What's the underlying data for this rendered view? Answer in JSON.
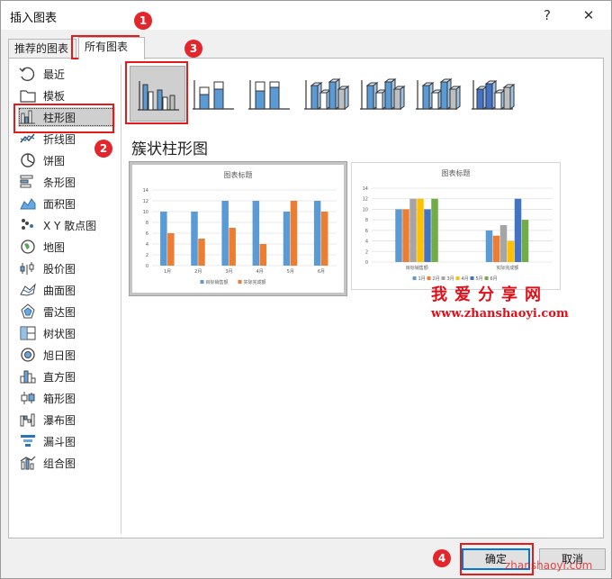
{
  "window": {
    "title": "插入图表",
    "help_glyph": "?",
    "close_glyph": "✕"
  },
  "tabs": [
    {
      "label": "推荐的图表",
      "active": false
    },
    {
      "label": "所有图表",
      "active": true
    }
  ],
  "sidebar": {
    "items": [
      {
        "label": "最近",
        "icon": "recent-icon"
      },
      {
        "label": "模板",
        "icon": "template-folder-icon"
      },
      {
        "label": "柱形图",
        "icon": "column-chart-icon",
        "selected": true
      },
      {
        "label": "折线图",
        "icon": "line-chart-icon"
      },
      {
        "label": "饼图",
        "icon": "pie-chart-icon"
      },
      {
        "label": "条形图",
        "icon": "bar-chart-icon"
      },
      {
        "label": "面积图",
        "icon": "area-chart-icon"
      },
      {
        "label": "X Y 散点图",
        "icon": "scatter-chart-icon"
      },
      {
        "label": "地图",
        "icon": "map-chart-icon"
      },
      {
        "label": "股价图",
        "icon": "stock-chart-icon"
      },
      {
        "label": "曲面图",
        "icon": "surface-chart-icon"
      },
      {
        "label": "雷达图",
        "icon": "radar-chart-icon"
      },
      {
        "label": "树状图",
        "icon": "treemap-chart-icon"
      },
      {
        "label": "旭日图",
        "icon": "sunburst-chart-icon"
      },
      {
        "label": "直方图",
        "icon": "histogram-chart-icon"
      },
      {
        "label": "箱形图",
        "icon": "box-whisker-chart-icon"
      },
      {
        "label": "瀑布图",
        "icon": "waterfall-chart-icon"
      },
      {
        "label": "漏斗图",
        "icon": "funnel-chart-icon"
      },
      {
        "label": "组合图",
        "icon": "combo-chart-icon"
      }
    ]
  },
  "subtypes": [
    {
      "icon": "clustered-column-icon",
      "selected": true
    },
    {
      "icon": "stacked-column-icon"
    },
    {
      "icon": "100-stacked-column-icon"
    },
    {
      "icon": "3d-clustered-column-icon"
    },
    {
      "icon": "3d-stacked-column-icon"
    },
    {
      "icon": "3d-100-stacked-column-icon"
    },
    {
      "icon": "3d-column-icon"
    }
  ],
  "subtype_title": "簇状柱形图",
  "previews": [
    {
      "chart_data": {
        "type": "bar",
        "title": "图表标题",
        "categories": [
          "1月",
          "2月",
          "3月",
          "4月",
          "5月",
          "6月"
        ],
        "series": [
          {
            "name": "目标销售额",
            "values": [
              10,
              10,
              12,
              12,
              10,
              12
            ],
            "color": "#5b9bd5"
          },
          {
            "name": "实际完成额",
            "values": [
              6,
              5,
              7,
              4,
              12,
              10
            ],
            "color": "#ed7d31"
          }
        ],
        "ylim": [
          0,
          14
        ],
        "yticks": [
          0,
          2,
          4,
          6,
          8,
          10,
          12,
          14
        ],
        "grid": true,
        "legend": "bottom"
      }
    },
    {
      "chart_data": {
        "type": "bar",
        "title": "图表标题",
        "categories": [
          "目标销售额",
          "实际完成额"
        ],
        "series": [
          {
            "name": "1月",
            "values": [
              10,
              6
            ],
            "color": "#5b9bd5"
          },
          {
            "name": "2月",
            "values": [
              10,
              5
            ],
            "color": "#ed7d31"
          },
          {
            "name": "3月",
            "values": [
              12,
              7
            ],
            "color": "#a5a5a5"
          },
          {
            "name": "4月",
            "values": [
              12,
              4
            ],
            "color": "#ffc000"
          },
          {
            "name": "5月",
            "values": [
              10,
              12
            ],
            "color": "#4472c4"
          },
          {
            "name": "6月",
            "values": [
              12,
              8
            ],
            "color": "#70ad47"
          }
        ],
        "ylim": [
          0,
          14
        ],
        "yticks": [
          0,
          2,
          4,
          6,
          8,
          10,
          12,
          14
        ],
        "grid": true,
        "legend": "bottom"
      }
    }
  ],
  "buttons": {
    "ok": "确定",
    "cancel": "取消"
  },
  "annotations": {
    "badges": [
      "1",
      "2",
      "3",
      "4"
    ]
  },
  "watermark": {
    "line1": "我爱分享网",
    "line2": "www.zhanshaoyi.com",
    "line3": "zhanshaoyi.com"
  }
}
